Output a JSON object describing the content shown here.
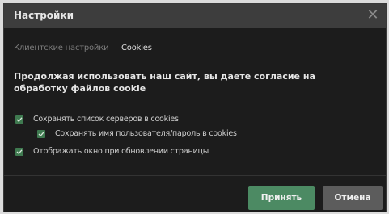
{
  "dialog": {
    "title": "Настройки",
    "close_glyph": "✕"
  },
  "tabs": [
    {
      "label": "Клиентские настройки",
      "active": false
    },
    {
      "label": "Cookies",
      "active": true
    }
  ],
  "notice": "Продолжая использовать наш сайт, вы даете согласие на обработку файлов cookie",
  "options": [
    {
      "label": "Сохранять список серверов в cookies",
      "checked": true
    },
    {
      "label": "Сохранять имя пользователя/пароль в cookies",
      "checked": true
    },
    {
      "label": "Отображать окно при обновлении страницы",
      "checked": true
    }
  ],
  "buttons": {
    "accept": "Принять",
    "cancel": "Отмена"
  },
  "colors": {
    "background": "#1c1c1c",
    "titlebar": "#3d3d3d",
    "checkbox": "#3f7a50",
    "accept_button": "#4c8a63",
    "cancel_button": "#5c5c5c"
  },
  "icons": {
    "close": "close-icon",
    "check": "checkmark-icon"
  }
}
